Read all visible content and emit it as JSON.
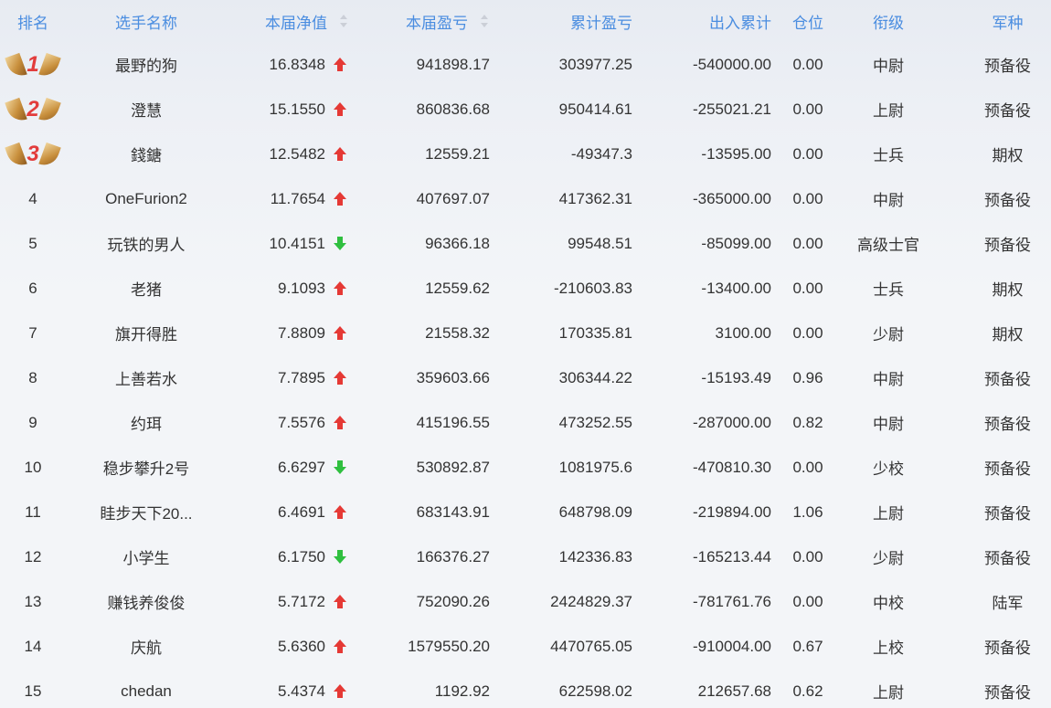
{
  "columns": {
    "rank": "排名",
    "name": "选手名称",
    "nav": "本届净值",
    "profit": "本届盈亏",
    "total": "累计盈亏",
    "inout": "出入累计",
    "position": "仓位",
    "military_rank": "衔级",
    "service": "军种"
  },
  "colors": {
    "header_text": "#4a8de0",
    "up_arrow": "#e53935",
    "down_arrow": "#2fbf3f",
    "medal_number": "#e23c3c"
  },
  "rows": [
    {
      "rank": "1",
      "medal": "wing-medal-1-icon",
      "name": "最野的狗",
      "nav": "16.8348",
      "direction": "up",
      "profit": "941898.17",
      "total": "303977.25",
      "inout": "-540000.00",
      "position": "0.00",
      "military_rank": "中尉",
      "service": "预备役"
    },
    {
      "rank": "2",
      "medal": "wing-medal-2-icon",
      "name": "澄慧",
      "nav": "15.1550",
      "direction": "up",
      "profit": "860836.68",
      "total": "950414.61",
      "inout": "-255021.21",
      "position": "0.00",
      "military_rank": "上尉",
      "service": "预备役"
    },
    {
      "rank": "3",
      "medal": "wing-medal-3-icon",
      "name": "錢鎕",
      "nav": "12.5482",
      "direction": "up",
      "profit": "12559.21",
      "total": "-49347.3",
      "inout": "-13595.00",
      "position": "0.00",
      "military_rank": "士兵",
      "service": "期权"
    },
    {
      "rank": "4",
      "name": "OneFurion2",
      "nav": "11.7654",
      "direction": "up",
      "profit": "407697.07",
      "total": "417362.31",
      "inout": "-365000.00",
      "position": "0.00",
      "military_rank": "中尉",
      "service": "预备役"
    },
    {
      "rank": "5",
      "name": "玩铁的男人",
      "nav": "10.4151",
      "direction": "down",
      "profit": "96366.18",
      "total": "99548.51",
      "inout": "-85099.00",
      "position": "0.00",
      "military_rank": "高级士官",
      "service": "预备役"
    },
    {
      "rank": "6",
      "name": "老猪",
      "nav": "9.1093",
      "direction": "up",
      "profit": "12559.62",
      "total": "-210603.83",
      "inout": "-13400.00",
      "position": "0.00",
      "military_rank": "士兵",
      "service": "期权"
    },
    {
      "rank": "7",
      "name": "旗开得胜",
      "nav": "7.8809",
      "direction": "up",
      "profit": "21558.32",
      "total": "170335.81",
      "inout": "3100.00",
      "position": "0.00",
      "military_rank": "少尉",
      "service": "期权"
    },
    {
      "rank": "8",
      "name": "上善若水",
      "nav": "7.7895",
      "direction": "up",
      "profit": "359603.66",
      "total": "306344.22",
      "inout": "-15193.49",
      "position": "0.96",
      "military_rank": "中尉",
      "service": "预备役"
    },
    {
      "rank": "9",
      "name": "约珥",
      "nav": "7.5576",
      "direction": "up",
      "profit": "415196.55",
      "total": "473252.55",
      "inout": "-287000.00",
      "position": "0.82",
      "military_rank": "中尉",
      "service": "预备役"
    },
    {
      "rank": "10",
      "name": "稳步攀升2号",
      "nav": "6.6297",
      "direction": "down",
      "profit": "530892.87",
      "total": "1081975.6",
      "inout": "-470810.30",
      "position": "0.00",
      "military_rank": "少校",
      "service": "预备役"
    },
    {
      "rank": "11",
      "name": "眭步天下20...",
      "nav": "6.4691",
      "direction": "up",
      "profit": "683143.91",
      "total": "648798.09",
      "inout": "-219894.00",
      "position": "1.06",
      "military_rank": "上尉",
      "service": "预备役"
    },
    {
      "rank": "12",
      "name": "小学生",
      "nav": "6.1750",
      "direction": "down",
      "profit": "166376.27",
      "total": "142336.83",
      "inout": "-165213.44",
      "position": "0.00",
      "military_rank": "少尉",
      "service": "预备役"
    },
    {
      "rank": "13",
      "name": "赚钱养俊俊",
      "nav": "5.7172",
      "direction": "up",
      "profit": "752090.26",
      "total": "2424829.37",
      "inout": "-781761.76",
      "position": "0.00",
      "military_rank": "中校",
      "service": "陆军"
    },
    {
      "rank": "14",
      "name": "庆航",
      "nav": "5.6360",
      "direction": "up",
      "profit": "1579550.20",
      "total": "4470765.05",
      "inout": "-910004.00",
      "position": "0.67",
      "military_rank": "上校",
      "service": "预备役"
    },
    {
      "rank": "15",
      "name": "chedan",
      "nav": "5.4374",
      "direction": "up",
      "profit": "1192.92",
      "total": "622598.02",
      "inout": "212657.68",
      "position": "0.62",
      "military_rank": "上尉",
      "service": "预备役"
    }
  ]
}
